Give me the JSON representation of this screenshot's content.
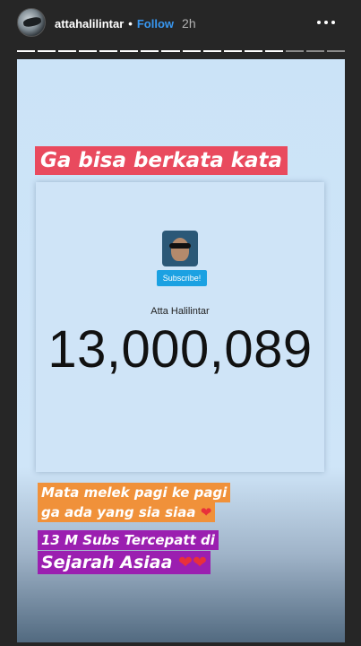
{
  "header": {
    "username": "attahalilintar",
    "separator": "•",
    "follow_label": "Follow",
    "time": "2h",
    "more_icon": "more-horizontal-icon"
  },
  "progress": {
    "segments_total": 16,
    "segments_viewed": 13
  },
  "story": {
    "title": "Ga bisa berkata kata",
    "card": {
      "subscribe_label": "Subscribe!",
      "channel_name": "Atta Halilintar",
      "subscriber_count": "13,000,089"
    },
    "captions": [
      {
        "text": "Mata melek pagi ke pagi",
        "suffix": ""
      },
      {
        "text": "ga ada yang sia siaa ",
        "suffix": "❤"
      },
      {
        "text": "13 M Subs Tercepatt di",
        "suffix": ""
      },
      {
        "text": "Sejarah Asiaa ",
        "suffix": "❤❤"
      }
    ]
  },
  "colors": {
    "title_bg": "#e94a5e",
    "caption_orange": "#f0913a",
    "caption_purple": "#9b1fb0",
    "follow": "#3897f0",
    "subscribe": "#1ba1e2"
  }
}
